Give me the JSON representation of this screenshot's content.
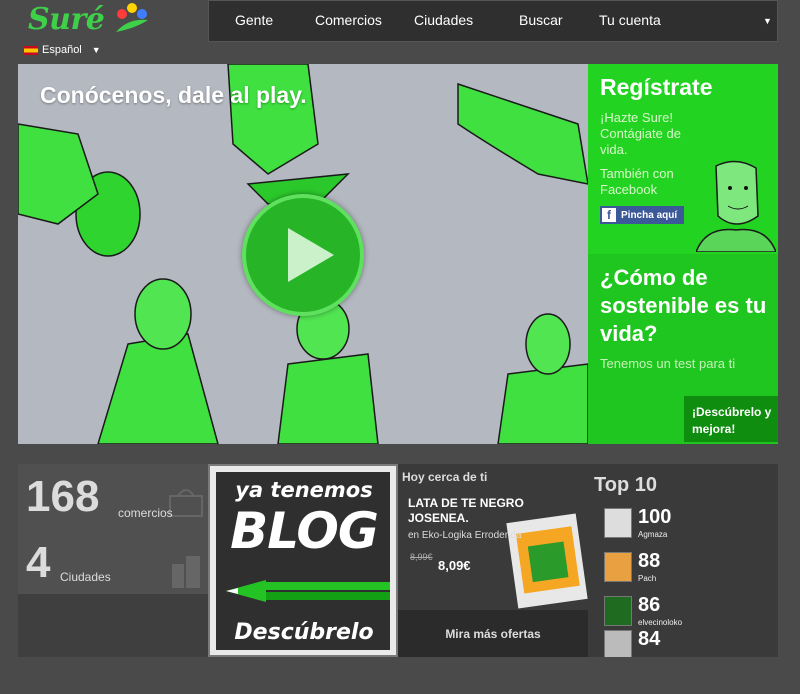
{
  "header": {
    "logo_text": "Suré",
    "language": "Español",
    "nav": [
      {
        "label": "Gente"
      },
      {
        "label": "Comercios"
      },
      {
        "label": "Ciudades"
      },
      {
        "label": "Buscar"
      },
      {
        "label": "Tu cuenta"
      }
    ]
  },
  "hero": {
    "title": "Conócenos, dale al play."
  },
  "register": {
    "title": "Regístrate",
    "text": "¡Hazte Sure! Contágiate de vida.",
    "facebook_text": "También con Facebook",
    "facebook_button": "Pincha aquí"
  },
  "sustainability": {
    "title": "¿Cómo de sostenible es tu vida?",
    "text": "Tenemos un test para ti",
    "button": "¡Descúbrelo y mejora!"
  },
  "stats": {
    "merchants_count": "168",
    "merchants_label": "comercios",
    "cities_count": "4",
    "cities_label": "Ciudades"
  },
  "blog": {
    "line1": "ya tenemos",
    "line2": "BLOG",
    "cta": "Descúbrelo"
  },
  "offers": {
    "heading": "Hoy cerca de ti",
    "title": "LATA DE TE NEGRO JOSENEA.",
    "shop": "en Eko-Logika Errodenda",
    "old_price": "8,99€",
    "price": "8,09€",
    "more": "Mira más ofertas"
  },
  "top10": {
    "title": "Top 10",
    "entries": [
      {
        "score": "100",
        "user": "Agmaza"
      },
      {
        "score": "88",
        "user": "Pach"
      },
      {
        "score": "86",
        "user": "elvecinoloko"
      },
      {
        "score": "84",
        "user": ""
      }
    ]
  },
  "colors": {
    "brand_green": "#22d322",
    "dark_panel": "#2f2f2f",
    "facebook": "#3b5998"
  }
}
